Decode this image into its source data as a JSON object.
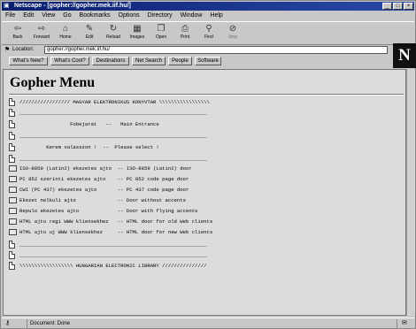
{
  "window": {
    "title": "Netscape - [gopher://gopher.mek.iif.hu/]",
    "controls": [
      "_",
      "□",
      "×"
    ]
  },
  "menu": [
    "File",
    "Edit",
    "View",
    "Go",
    "Bookmarks",
    "Options",
    "Directory",
    "Window",
    "Help"
  ],
  "toolbar": [
    {
      "label": "Back",
      "icon": "back-arrow-icon",
      "glyph": "⇦"
    },
    {
      "label": "Forward",
      "icon": "forward-arrow-icon",
      "glyph": "⇨"
    },
    {
      "label": "Home",
      "icon": "home-icon",
      "glyph": "⌂"
    },
    {
      "label": "Edit",
      "icon": "pencil-icon",
      "glyph": "✎"
    },
    {
      "label": "Reload",
      "icon": "reload-icon",
      "glyph": "↻"
    },
    {
      "label": "Images",
      "icon": "images-icon",
      "glyph": "▦"
    },
    {
      "label": "Open",
      "icon": "open-icon",
      "glyph": "❐"
    },
    {
      "label": "Print",
      "icon": "print-icon",
      "glyph": "⎙"
    },
    {
      "label": "Find",
      "icon": "find-icon",
      "glyph": "⚲"
    },
    {
      "label": "Stop",
      "icon": "stop-icon",
      "glyph": "⊘"
    }
  ],
  "location": {
    "label": "Location:",
    "value": "gopher://gopher.mek.iif.hu/"
  },
  "directory_buttons": [
    "What's New?",
    "What's Cool?",
    "Destinations",
    "Net Search",
    "People",
    "Software"
  ],
  "logo": "N",
  "page": {
    "heading": "Gopher Menu",
    "items": [
      {
        "kind": "doc",
        "text": "///////////////// MAGYAR ELEKTRONIKUS KONYVTAR \\\\\\\\\\\\\\\\\\\\\\\\\\\\\\\\\\"
      },
      {
        "kind": "doc",
        "text": "_______________________________________________________________"
      },
      {
        "kind": "doc",
        "text": "                 Fobejarat   --   Main Entrance"
      },
      {
        "kind": "doc",
        "text": "_______________________________________________________________"
      },
      {
        "kind": "doc",
        "text": "         Kerem valasszon !  --  Please select !"
      },
      {
        "kind": "doc",
        "text": "_______________________________________________________________"
      },
      {
        "kind": "folder",
        "text": "ISO-8859 (Latin2) ekezetes ajto  -- ISO-8859 (Latin2) door"
      },
      {
        "kind": "folder",
        "text": "PC 852 szerinti ekezetes ajto    -- PC 852 code page door"
      },
      {
        "kind": "folder",
        "text": "CWI (PC 437) ekezetes ajto       -- PC 437 code page door"
      },
      {
        "kind": "folder",
        "text": "Ekezet nelkuli ajto              -- Door without accents"
      },
      {
        "kind": "folder",
        "text": "Repulo ekezetes ajto             -- Door with flying accents"
      },
      {
        "kind": "folder",
        "text": "HTML ajto regi WWW kliensekhez   -- HTML door for old Web clients"
      },
      {
        "kind": "folder",
        "text": "HTML ajto uj WWW kliensekhez     -- HTML door for new Web clients"
      },
      {
        "kind": "doc",
        "text": "_______________________________________________________________"
      },
      {
        "kind": "doc",
        "text": "_______________________________________________________________"
      },
      {
        "kind": "doc",
        "text": "\\\\\\\\\\\\\\\\\\\\\\\\\\\\\\\\\\\\ HUNGARIAN ELECTRONIC LIBRARY ///////////////"
      }
    ]
  },
  "status": {
    "text": "Document: Done"
  }
}
